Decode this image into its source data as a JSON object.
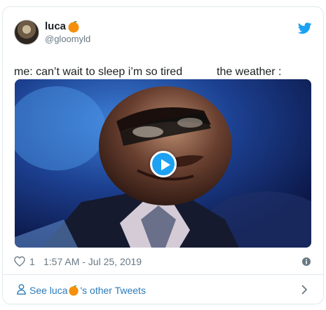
{
  "tweet": {
    "author": {
      "name": "luca",
      "handle": "@gloomyld",
      "name_emoji": "orange-emoji-icon"
    },
    "text": "me: can’t wait to sleep i’m so tired           the weather :",
    "media": {
      "type": "video",
      "play_icon": "play-icon"
    },
    "likes": "1",
    "timestamp": "1:57 AM - Jul 25, 2019"
  },
  "footer": {
    "prefix": "See luca",
    "suffix": "'s other Tweets"
  },
  "colors": {
    "twitter_blue": "#1da1f2",
    "link_blue": "#2b7bb9",
    "secondary_gray": "#697882",
    "border": "#e1e8ed"
  }
}
